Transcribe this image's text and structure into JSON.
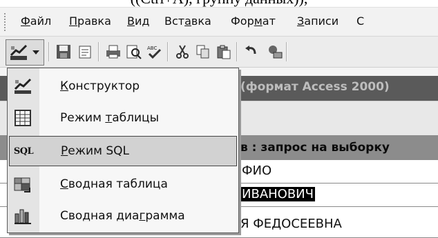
{
  "caption": "((Ctrl+A), группу данных)),",
  "menubar": {
    "items": [
      {
        "label": "Файл",
        "accel": "Ф",
        "rest": "айл"
      },
      {
        "label": "Правка",
        "accel": "П",
        "rest": "равка"
      },
      {
        "label": "Вид",
        "accel": "В",
        "rest": "ид"
      },
      {
        "label": "Вставка",
        "pre": "Вст",
        "accel": "а",
        "rest": "вка"
      },
      {
        "label": "Формат",
        "pre": "Фор",
        "accel": "м",
        "rest": "ат"
      },
      {
        "label": "Записи",
        "accel": "З",
        "rest": "аписи"
      },
      {
        "label": "С"
      }
    ]
  },
  "toolbar": {
    "view_button_icon": "design-view-icon",
    "buttons": [
      "save-icon",
      "properties-icon",
      "print-icon",
      "print-preview-icon",
      "spelling-icon",
      "cut-icon",
      "copy-icon",
      "paste-icon",
      "undo-icon",
      "relationships-icon"
    ]
  },
  "dropdown": {
    "items": [
      {
        "icon": "design-view-icon",
        "accel": "К",
        "rest": "онструктор"
      },
      {
        "icon": "datasheet-view-icon",
        "pre": "Режим ",
        "accel": "т",
        "rest": "аблицы"
      },
      {
        "icon": "sql-view-icon",
        "icon_text": "SQL",
        "pre": "",
        "accel": "Р",
        "rest": "ежим SQL",
        "highlighted": true
      },
      {
        "icon": "pivot-table-icon",
        "accel": "С",
        "rest": "водная таблица"
      },
      {
        "icon": "pivot-chart-icon",
        "pre": "Сводная диа",
        "accel": "г",
        "rest": "рамма"
      }
    ]
  },
  "background": {
    "title_fragment": "(формат Access 2000)",
    "query_fragment": "в : запрос на выборку",
    "rows": [
      "ФИО",
      "ИВАНОВИЧ",
      "Я ФЕДОСЕЕВНА"
    ],
    "bottom_fragment": "Я ФЕДОСЕЕВНА"
  }
}
